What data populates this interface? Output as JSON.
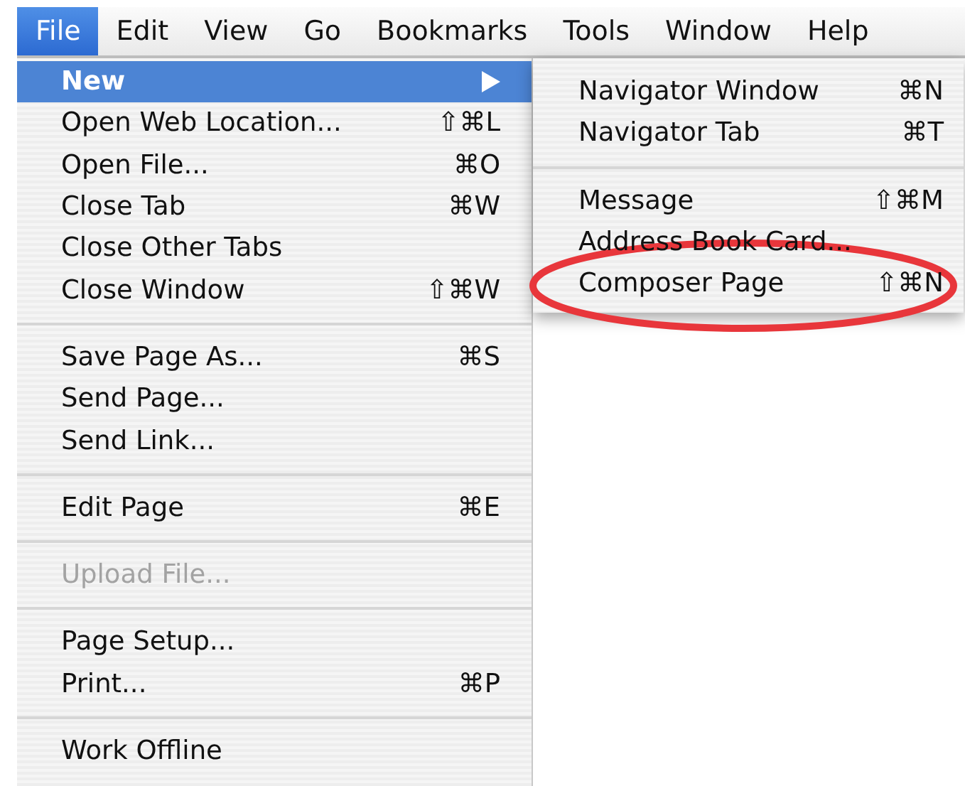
{
  "menubar": [
    {
      "label": "File",
      "selected": true
    },
    {
      "label": "Edit",
      "selected": false
    },
    {
      "label": "View",
      "selected": false
    },
    {
      "label": "Go",
      "selected": false
    },
    {
      "label": "Bookmarks",
      "selected": false
    },
    {
      "label": "Tools",
      "selected": false
    },
    {
      "label": "Window",
      "selected": false
    },
    {
      "label": "Help",
      "selected": false
    }
  ],
  "file_menu": {
    "items": [
      {
        "kind": "item",
        "label": "New",
        "submenu": true,
        "selected": true,
        "disabled": false
      },
      {
        "kind": "item",
        "label": "Open Web Location...",
        "shortcut": "⇧⌘L",
        "selected": false,
        "disabled": false
      },
      {
        "kind": "item",
        "label": "Open File...",
        "shortcut": "⌘O",
        "selected": false,
        "disabled": false
      },
      {
        "kind": "item",
        "label": "Close Tab",
        "shortcut": "⌘W",
        "selected": false,
        "disabled": false
      },
      {
        "kind": "item",
        "label": "Close Other Tabs",
        "selected": false,
        "disabled": false
      },
      {
        "kind": "item",
        "label": "Close Window",
        "shortcut": "⇧⌘W",
        "selected": false,
        "disabled": false
      },
      {
        "kind": "separator"
      },
      {
        "kind": "item",
        "label": "Save Page As...",
        "shortcut": "⌘S",
        "selected": false,
        "disabled": false
      },
      {
        "kind": "item",
        "label": "Send Page...",
        "selected": false,
        "disabled": false
      },
      {
        "kind": "item",
        "label": "Send Link...",
        "selected": false,
        "disabled": false
      },
      {
        "kind": "separator"
      },
      {
        "kind": "item",
        "label": "Edit Page",
        "shortcut": "⌘E",
        "selected": false,
        "disabled": false
      },
      {
        "kind": "separator"
      },
      {
        "kind": "item",
        "label": "Upload File...",
        "selected": false,
        "disabled": true
      },
      {
        "kind": "separator"
      },
      {
        "kind": "item",
        "label": "Page Setup...",
        "selected": false,
        "disabled": false
      },
      {
        "kind": "item",
        "label": "Print...",
        "shortcut": "⌘P",
        "selected": false,
        "disabled": false
      },
      {
        "kind": "separator"
      },
      {
        "kind": "item",
        "label": "Work Offline",
        "selected": false,
        "disabled": false
      }
    ]
  },
  "new_submenu": {
    "items": [
      {
        "kind": "item",
        "label": "Navigator Window",
        "shortcut": "⌘N",
        "selected": false,
        "disabled": false
      },
      {
        "kind": "item",
        "label": "Navigator Tab",
        "shortcut": "⌘T",
        "selected": false,
        "disabled": false
      },
      {
        "kind": "separator"
      },
      {
        "kind": "item",
        "label": "Message",
        "shortcut": "⇧⌘M",
        "selected": false,
        "disabled": false
      },
      {
        "kind": "item",
        "label": "Address Book Card...",
        "selected": false,
        "disabled": false
      },
      {
        "kind": "item",
        "label": "Composer Page",
        "shortcut": "⇧⌘N",
        "selected": false,
        "disabled": false
      }
    ]
  }
}
